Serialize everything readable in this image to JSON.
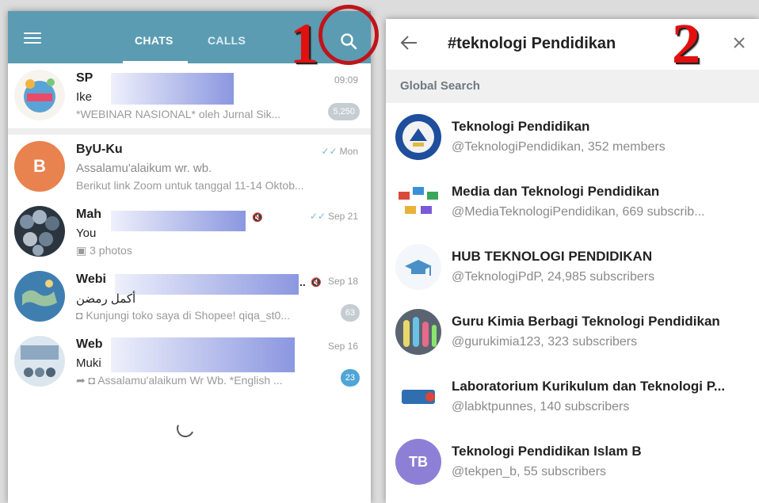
{
  "left": {
    "tabs": [
      {
        "label": "CHATS"
      },
      {
        "label": "CALLS"
      }
    ],
    "chats": [
      {
        "name": "SP",
        "line2": "Ike",
        "line3": "*WEBINAR NASIONAL* oleh Jurnal Sik...",
        "time": "09:09",
        "badge": "5,250"
      },
      {
        "name": "ByU-Ku",
        "line2": "Assalamu'alaikum wr. wb.",
        "line3": "Berikut link Zoom untuk tanggal 11-14 Oktob...",
        "time": "Mon",
        "avatar_letter": "B"
      },
      {
        "name": "Mah",
        "line2": "You",
        "line3": "3 photos",
        "time": "Sep 21"
      },
      {
        "name": "Webi",
        "line2": "أكمل رمضن",
        "line3": "Kunjungi toko saya di Shopee! qiqa_st0...",
        "time": "Sep 18",
        "badge": "63"
      },
      {
        "name": "Web",
        "line2": "Muki",
        "line3": "Assalamu'alaikum Wr Wb.  *English ...",
        "time": "Sep 16",
        "badge": "23"
      }
    ]
  },
  "right": {
    "search_query": "#teknologi Pendidikan",
    "section_label": "Global Search",
    "results": [
      {
        "title": "Teknologi Pendidikan",
        "subtitle": "@TeknologiPendidikan, 352 members"
      },
      {
        "title": "Media dan Teknologi Pendidikan",
        "subtitle": "@MediaTeknologiPendidikan, 669 subscrib..."
      },
      {
        "title": "HUB TEKNOLOGI PENDIDIKAN",
        "subtitle": "@TeknologiPdP, 24,985 subscribers"
      },
      {
        "title": "Guru Kimia Berbagi Teknologi Pendidikan",
        "subtitle": "@gurukimia123, 323 subscribers"
      },
      {
        "title": "Laboratorium Kurikulum dan Teknologi P...",
        "subtitle": "@labktpunnes, 140 subscribers"
      },
      {
        "title": "Teknologi Pendidikan Islam B",
        "subtitle": "@tekpen_b, 55 subscribers",
        "avatar_text": "TB"
      }
    ]
  },
  "annotations": {
    "step1": "1",
    "step2": "2"
  },
  "colors": {
    "header": "#5b9cb2",
    "highlight": "#c0141a",
    "step_number": "#e21010"
  }
}
